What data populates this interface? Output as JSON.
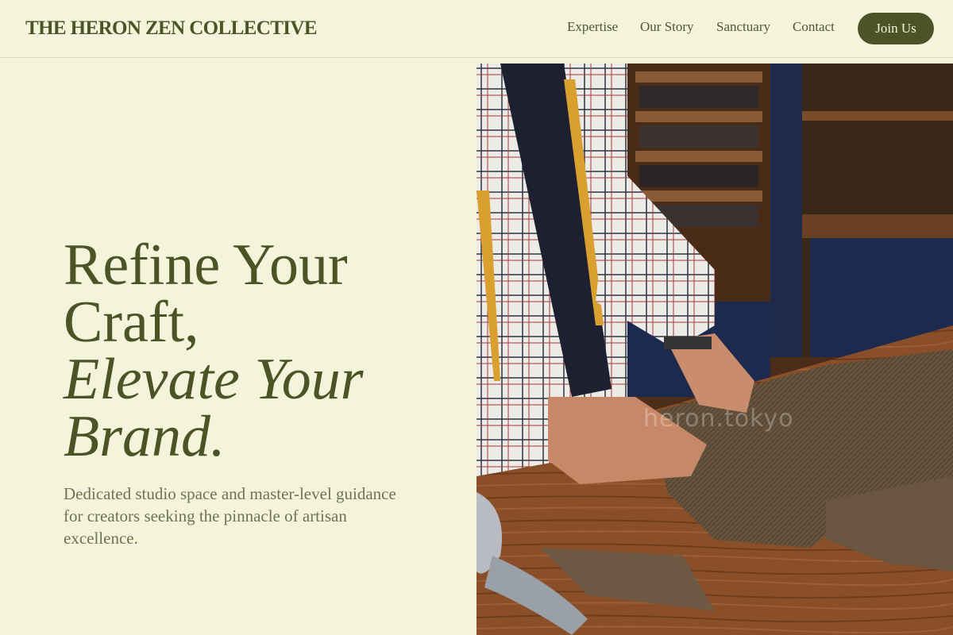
{
  "header": {
    "brand": "THE HERON ZEN COLLECTIVE",
    "nav": [
      {
        "label": "Expertise"
      },
      {
        "label": "Our Story"
      },
      {
        "label": "Sanctuary"
      },
      {
        "label": "Contact"
      }
    ],
    "cta_label": "Join Us"
  },
  "hero": {
    "headline_line1": "Refine Your",
    "headline_line2": "Craft,",
    "headline_line3": "Elevate Your",
    "headline_line4": "Brand.",
    "subtext": "Dedicated studio space and master-level guidance for creators seeking the pinnacle of artisan excellence.",
    "image": {
      "watermark": "heron.tokyo"
    }
  },
  "colors": {
    "background": "#f4f4dc",
    "accent": "#4a5424",
    "muted_text": "#6e7450"
  }
}
